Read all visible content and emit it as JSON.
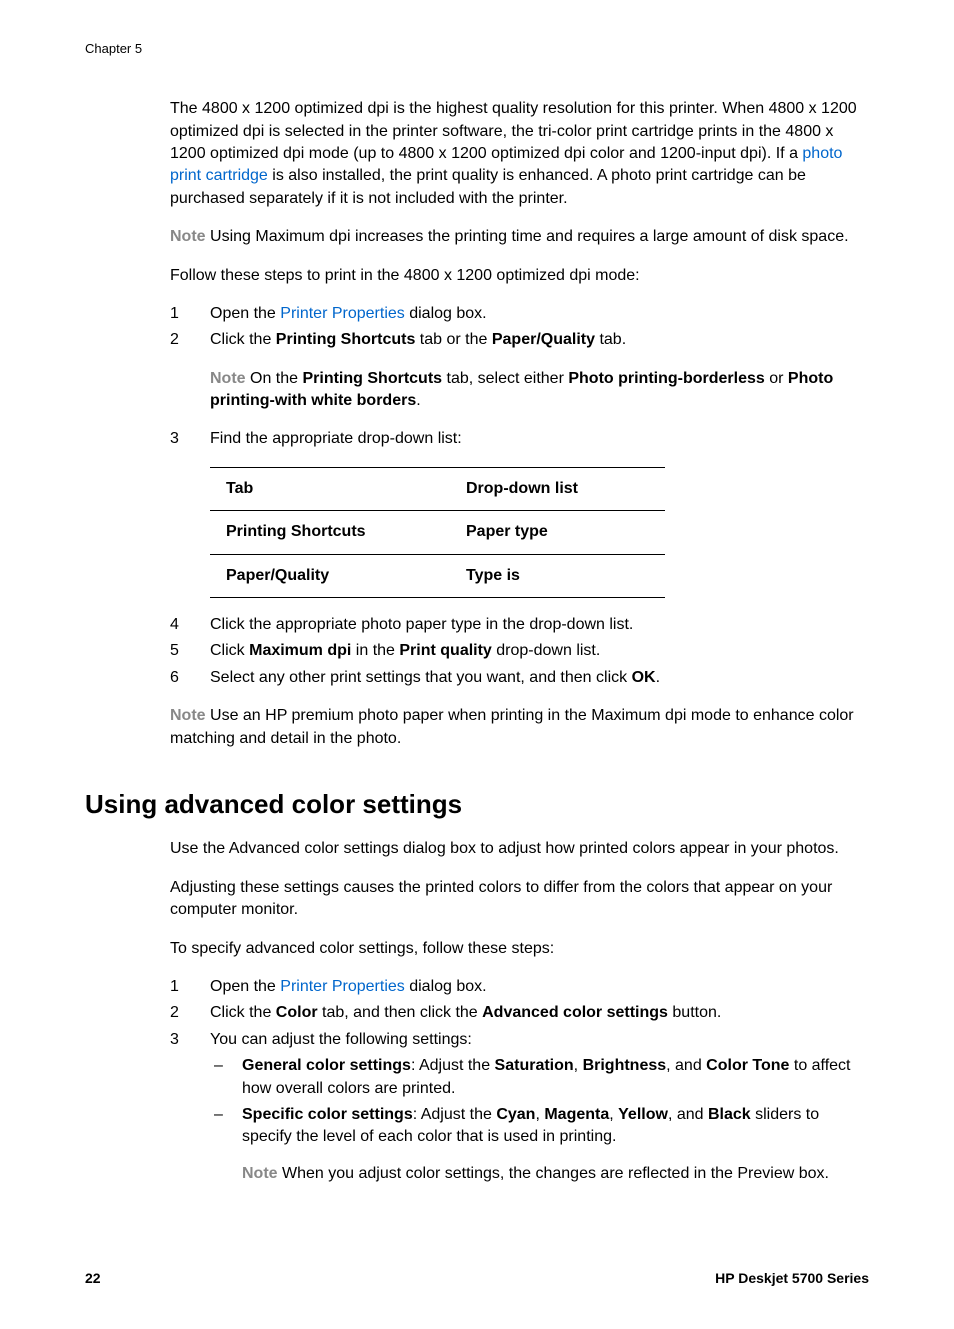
{
  "header": {
    "chapter": "Chapter 5"
  },
  "section1": {
    "p1_a": "The 4800 x 1200 optimized dpi is the highest quality resolution for this printer. When 4800 x 1200 optimized dpi is selected in the printer software, the tri-color print cartridge prints in the 4800 x 1200 optimized dpi mode (up to 4800 x 1200 optimized dpi color and 1200-input dpi). If a ",
    "p1_link": "photo print cartridge",
    "p1_b": " is also installed, the print quality is enhanced. A photo print cartridge can be purchased separately if it is not included with the printer.",
    "note1_label": "Note",
    "note1_text": "   Using Maximum dpi increases the printing time and requires a large amount of disk space.",
    "p2": "Follow these steps to print in the 4800 x 1200 optimized dpi mode:",
    "step1_num": "1",
    "step1_a": "Open the ",
    "step1_link": "Printer Properties",
    "step1_b": " dialog box.",
    "step2_num": "2",
    "step2_a": "Click the ",
    "step2_bold1": "Printing Shortcuts",
    "step2_b": " tab or the ",
    "step2_bold2": "Paper/Quality",
    "step2_c": " tab.",
    "note2_label": "Note",
    "note2_a": "   On the ",
    "note2_bold1": "Printing Shortcuts",
    "note2_b": " tab, select either ",
    "note2_bold2": "Photo printing-borderless",
    "note2_c": " or ",
    "note2_bold3": "Photo printing-with white borders",
    "note2_d": ".",
    "step3_num": "3",
    "step3_text": "Find the appropriate drop-down list:",
    "table_h1": "Tab",
    "table_h2": "Drop-down list",
    "table_r1c1": "Printing Shortcuts",
    "table_r1c2": "Paper type",
    "table_r2c1": "Paper/Quality",
    "table_r2c2": "Type is",
    "step4_num": "4",
    "step4_text": "Click the appropriate photo paper type in the drop-down list.",
    "step5_num": "5",
    "step5_a": "Click ",
    "step5_bold1": "Maximum dpi",
    "step5_b": " in the ",
    "step5_bold2": "Print quality",
    "step5_c": " drop-down list.",
    "step6_num": "6",
    "step6_a": "Select any other print settings that you want, and then click ",
    "step6_bold": "OK",
    "step6_b": ".",
    "note3_label": "Note",
    "note3_text": "   Use an HP premium photo paper when printing in the Maximum dpi mode to enhance color matching and detail in the photo."
  },
  "section2": {
    "heading": "Using advanced color settings",
    "p1": "Use the Advanced color settings dialog box to adjust how printed colors appear in your photos.",
    "p2": "Adjusting these settings causes the printed colors to differ from the colors that appear on your computer monitor.",
    "p3": "To specify advanced color settings, follow these steps:",
    "step1_num": "1",
    "step1_a": "Open the ",
    "step1_link": "Printer Properties",
    "step1_b": " dialog box.",
    "step2_num": "2",
    "step2_a": "Click the ",
    "step2_bold1": "Color",
    "step2_b": " tab, and then click the ",
    "step2_bold2": "Advanced color settings",
    "step2_c": " button.",
    "step3_num": "3",
    "step3_text": "You can adjust the following settings:",
    "bullet1_dash": "–",
    "bullet1_bold1": "General color settings",
    "bullet1_a": ": Adjust the ",
    "bullet1_bold2": "Saturation",
    "bullet1_b": ", ",
    "bullet1_bold3": "Brightness",
    "bullet1_c": ", and ",
    "bullet1_bold4": "Color Tone",
    "bullet1_d": " to affect how overall colors are printed.",
    "bullet2_dash": "–",
    "bullet2_bold1": "Specific color settings",
    "bullet2_a": ": Adjust the ",
    "bullet2_bold2": "Cyan",
    "bullet2_b": ", ",
    "bullet2_bold3": "Magenta",
    "bullet2_c": ", ",
    "bullet2_bold4": "Yellow",
    "bullet2_d": ", and ",
    "bullet2_bold5": "Black",
    "bullet2_e": " sliders to specify the level of each color that is used in printing.",
    "subnote_label": "Note",
    "subnote_text": "   When you adjust color settings, the changes are reflected in the Preview box."
  },
  "footer": {
    "page": "22",
    "title": "HP Deskjet 5700 Series"
  }
}
